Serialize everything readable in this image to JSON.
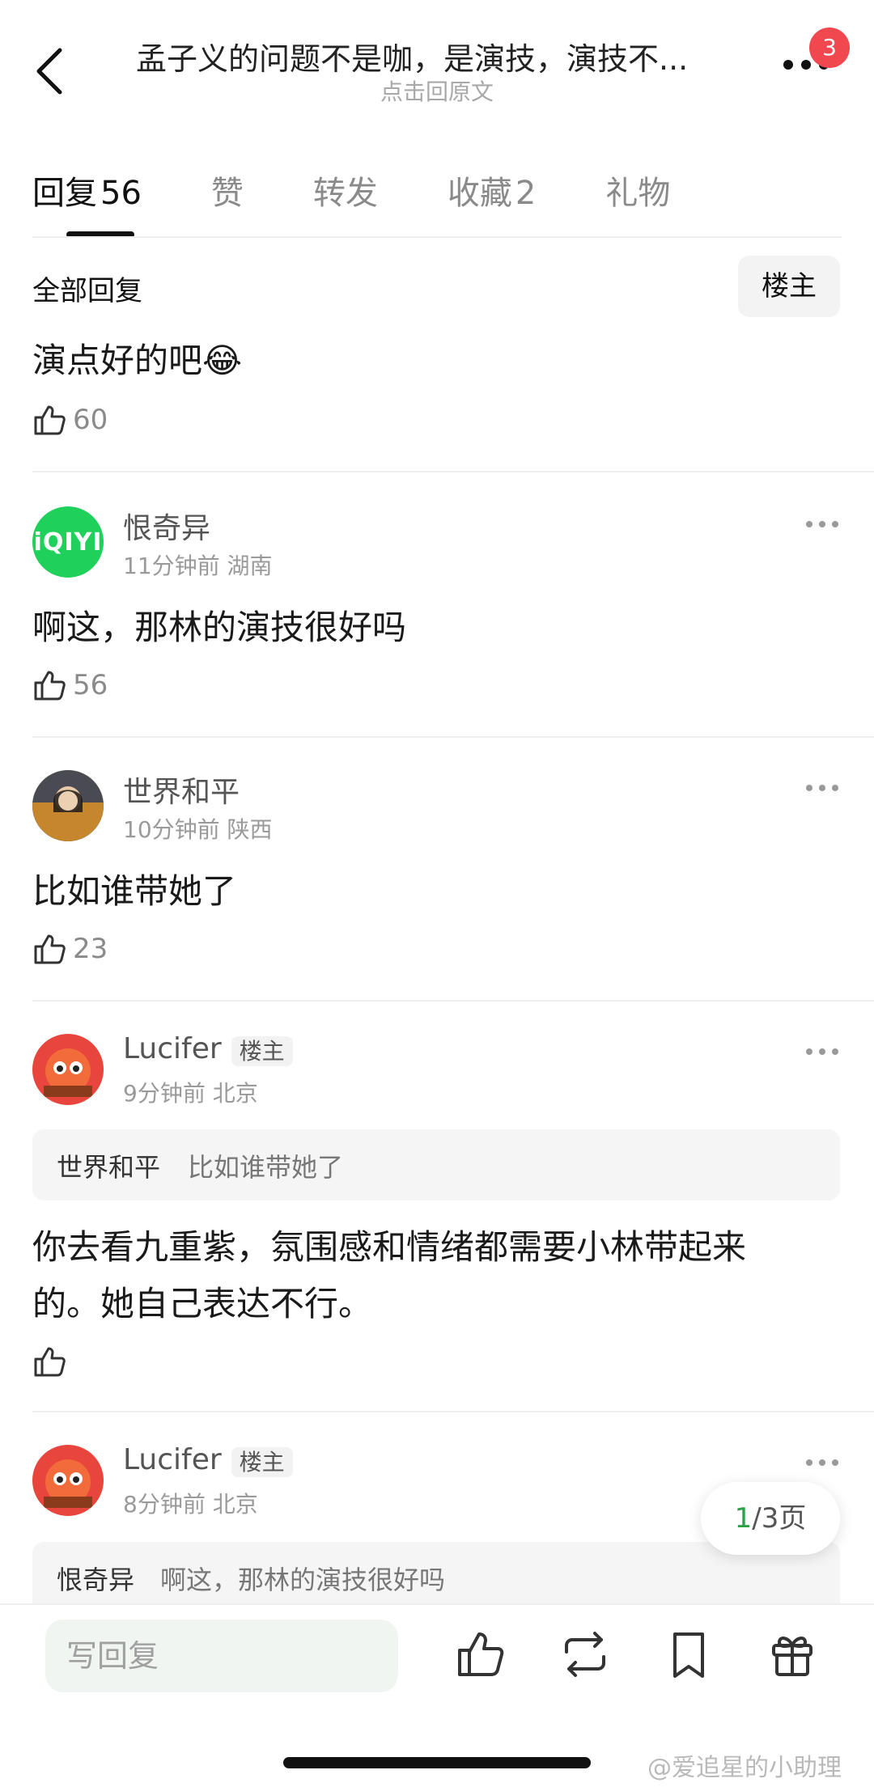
{
  "header": {
    "title": "孟子义的问题不是咖，是演技，演技不...",
    "subtitle": "点击回原文",
    "notification_count": "3"
  },
  "tabs": [
    {
      "label": "回复",
      "count": "56",
      "active": true
    },
    {
      "label": "赞",
      "count": "",
      "active": false
    },
    {
      "label": "转发",
      "count": "",
      "active": false
    },
    {
      "label": "收藏",
      "count": "2",
      "active": false
    },
    {
      "label": "礼物",
      "count": "",
      "active": false
    }
  ],
  "section": {
    "title": "全部回复",
    "op_filter_label": "楼主"
  },
  "top_comment": {
    "text": "演点好的吧😂",
    "likes": "60"
  },
  "comments": [
    {
      "user": "恨奇异",
      "avatar": "iQIYI",
      "time": "11分钟前",
      "location": "湖南",
      "text": "啊这，那林的演技很好吗",
      "likes": "56"
    },
    {
      "user": "世界和平",
      "avatar": "photo",
      "time": "10分钟前",
      "location": "陕西",
      "text": "比如谁带她了",
      "likes": "23"
    },
    {
      "user": "Lucifer",
      "is_op": true,
      "op_tag": "楼主",
      "time": "9分钟前",
      "location": "北京",
      "quote_user": "世界和平",
      "quote_text": "比如谁带她了",
      "text_line1": "你去看九重紫，氛围感和情绪都需要小林带起来",
      "text_line2": "的。她自己表达不行。",
      "likes": ""
    },
    {
      "user": "Lucifer",
      "is_op": true,
      "op_tag": "楼主",
      "time": "8分钟前",
      "location": "北京",
      "quote_user": "恨奇异",
      "quote_text": "啊这，那林的演技很好吗"
    }
  ],
  "pagination": {
    "current": "1",
    "total_label": "/3页"
  },
  "bottom_bar": {
    "reply_placeholder": "写回复"
  },
  "watermark": "@爱追星的小助理",
  "colors": {
    "accent_green": "#2aa245",
    "badge_red": "#f0484e",
    "iqiyi_green": "#1fd05a"
  }
}
